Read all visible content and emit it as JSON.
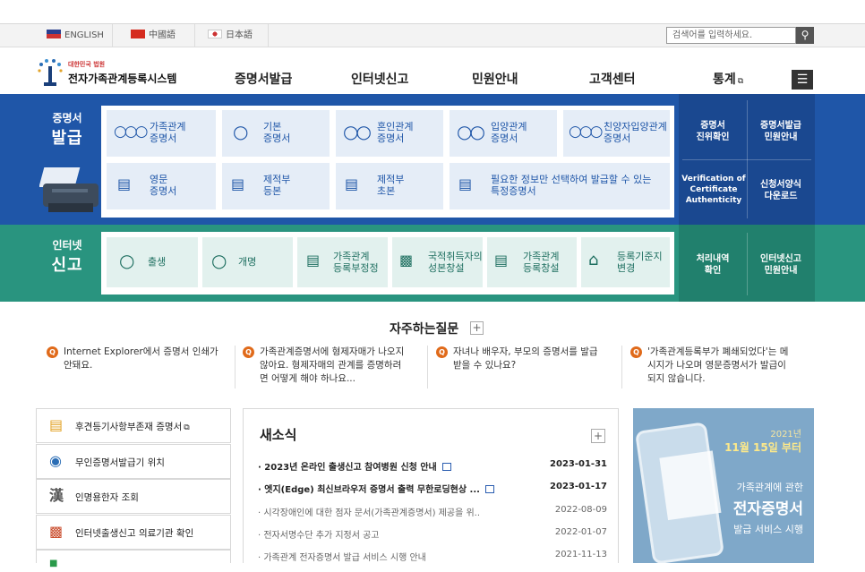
{
  "lang": {
    "english": "ENGLISH",
    "chinese": "中國語",
    "japanese": "日本語"
  },
  "search": {
    "placeholder": "검색어를 입력하세요."
  },
  "logo": {
    "sub": "대한민국 법원",
    "main": "전자가족관계등록시스템"
  },
  "gnb": [
    "증명서발급",
    "인터넷신고",
    "민원안내",
    "고객센터",
    "통계"
  ],
  "issue": {
    "label_small": "증명서",
    "label_big": "발급",
    "tiles": [
      {
        "label": "가족관계\n증명서",
        "icon": "family-icon"
      },
      {
        "label": "기본\n증명서",
        "icon": "person-icon"
      },
      {
        "label": "혼인관계\n증명서",
        "icon": "marriage-icon"
      },
      {
        "label": "입양관계\n증명서",
        "icon": "adoption-icon"
      },
      {
        "label": "친양자입양관계\n증명서",
        "icon": "full-adoption-icon"
      },
      {
        "label": "영문\n증명서",
        "icon": "english-doc-icon"
      },
      {
        "label": "제적부\n등본",
        "icon": "removed-register-icon"
      },
      {
        "label": "제적부\n초본",
        "icon": "removed-extract-icon"
      },
      {
        "label": "필요한 정보만 선택하여 발급할 수 있는\n특정증명서",
        "icon": "search-doc-icon"
      }
    ],
    "links": [
      "증명서\n진위확인",
      "증명서발급\n민원안내",
      "Verification of\nCertificate\nAuthenticity",
      "신청서양식\n다운로드"
    ]
  },
  "report": {
    "label_small": "인터넷",
    "label_big": "신고",
    "tiles": [
      {
        "label": "출생",
        "icon": "birth-icon"
      },
      {
        "label": "개명",
        "icon": "rename-icon"
      },
      {
        "label": "가족관계\n등록부정정",
        "icon": "correction-icon"
      },
      {
        "label": "국적취득자의\n성본창설",
        "icon": "nationality-icon"
      },
      {
        "label": "가족관계\n등록창설",
        "icon": "register-create-icon"
      },
      {
        "label": "등록기준지\n변경",
        "icon": "home-change-icon"
      }
    ],
    "links": [
      "처리내역\n확인",
      "인터넷신고\n민원안내"
    ]
  },
  "faq": {
    "title": "자주하는질문",
    "items": [
      "Internet Explorer에서 증명서 인쇄가\n안돼요.",
      "가족관계증명서에 형제자매가 나오지\n않아요. 형제자매의 관계를 증명하려\n면 어떻게 해야 하나요...",
      "자녀나 배우자, 부모의 증명서를 발급\n받을 수 있나요?",
      "'가족관계등록부가 폐쇄되었다'는 메\n시지가 나오며 영문증명서가 발급이\n되지 않습니다."
    ]
  },
  "leftlinks": [
    {
      "label": "후견등기사항부존재 증명서",
      "icon": "document-icon"
    },
    {
      "label": "무인증명서발급기 위치",
      "icon": "location-icon"
    },
    {
      "label": "인명용한자 조회",
      "icon": "hanja-icon"
    },
    {
      "label": "인터넷출생신고 의료기관 확인",
      "icon": "hospital-icon"
    }
  ],
  "news": {
    "title": "새소식",
    "items": [
      {
        "title": "2023년 온라인 출생신고 참여병원 신청 안내",
        "date": "2023-01-31",
        "new": true
      },
      {
        "title": "엣지(Edge) 최신브라우저 증명서 출력 무한로딩현상 ...",
        "date": "2023-01-17",
        "new": true
      },
      {
        "title": "시각장애인에 대한 점자 문서(가족관계증명서) 제공을 위..",
        "date": "2022-08-09",
        "new": false
      },
      {
        "title": "전자서명수단 추가 지정서 공고",
        "date": "2022-01-07",
        "new": false
      },
      {
        "title": "가족관계 전자증명서 발급 서비스 시행 안내",
        "date": "2021-11-13",
        "new": false
      }
    ]
  },
  "banner": {
    "year": "2021년",
    "date": "11월 15일 부터",
    "line1": "가족관계에 관한",
    "line2": "전자증명서",
    "line3": "발급 서비스 시행"
  }
}
